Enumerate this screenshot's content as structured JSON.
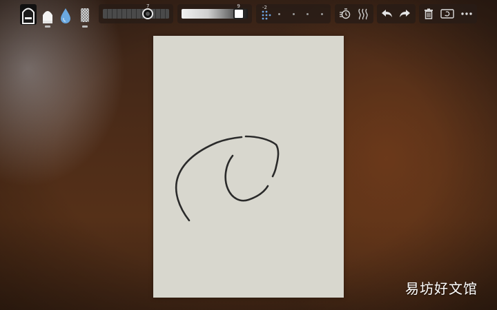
{
  "toolbar": {
    "tools": [
      {
        "name": "marker",
        "icon": "marker-brush-icon",
        "selected": true
      },
      {
        "name": "pencil",
        "icon": "pencil-brush-icon",
        "selected": false
      },
      {
        "name": "watercolor",
        "icon": "water-drop-icon",
        "selected": false
      },
      {
        "name": "eraser",
        "icon": "eraser-icon",
        "selected": false
      }
    ],
    "size": {
      "label": "7",
      "level": 0.68
    },
    "opacity": {
      "label": "9",
      "level": 0.86
    },
    "symmetry": {
      "label": "-2",
      "icon": "symmetry-grid-icon"
    },
    "misc": [
      {
        "icon": "timer-refresh-icon"
      },
      {
        "icon": "wave-smudge-icon"
      }
    ],
    "history": [
      {
        "icon": "undo-icon"
      },
      {
        "icon": "redo-icon"
      }
    ],
    "actions": [
      {
        "icon": "trash-icon"
      },
      {
        "icon": "clear-canvas-icon"
      },
      {
        "icon": "more-icon"
      }
    ]
  },
  "colors": {
    "paper": "#d8d7ce",
    "ink": "#2a2a2a",
    "toolbar_bg": "#281c16"
  },
  "watermark": "易坊好文馆"
}
